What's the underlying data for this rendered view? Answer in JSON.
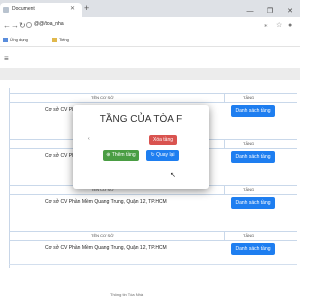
{
  "browser": {
    "tab_title": "Document",
    "tab_close": "✕",
    "new_tab": "+",
    "window_controls": [
      "—",
      "❐",
      "✕"
    ],
    "url": "@@/toa_nha",
    "bookmarks": [
      "Ứng dụng",
      "Tiếng"
    ]
  },
  "page": {
    "menu_icon": "≡",
    "blocks": [
      {
        "header_name": "TÊN CƠ SỞ",
        "header_floors": "TẦNG",
        "address": "Cơ sở CV Phần Mềm Quang Trung, Quận 12, TP.HCM"
      },
      {
        "header_name": "TÊN CƠ SỞ",
        "header_floors": "TẦNG",
        "address": "Cơ sở CV Phần Mềm Quang Trung, Quận 12, TP.HCM"
      },
      {
        "header_name": "TÊN CƠ SỞ",
        "header_floors": "TẦNG",
        "address": "Cơ sở CV Phần Mềm Quang Trung, Quận 12, TP.HCM"
      },
      {
        "header_name": "TÊN CƠ SỞ",
        "header_floors": "TẦNG",
        "address": "Cơ sở CV Phần Mềm Quang Trung, Quận 12, TP.HCM"
      }
    ],
    "list_button_label": "Danh sách tầng",
    "footer_text": "Thông tin Tòa Nhà"
  },
  "modal": {
    "title": "TẦNG CỦA TÒA F",
    "caret": "‹",
    "delete_label": "Xóa tầng",
    "add_label": "⊕ Thêm tầng",
    "back_label": "↻ Quay lại"
  },
  "colors": {
    "primary": "#1e7ef0",
    "danger": "#d9534f",
    "success": "#4a9d43"
  }
}
